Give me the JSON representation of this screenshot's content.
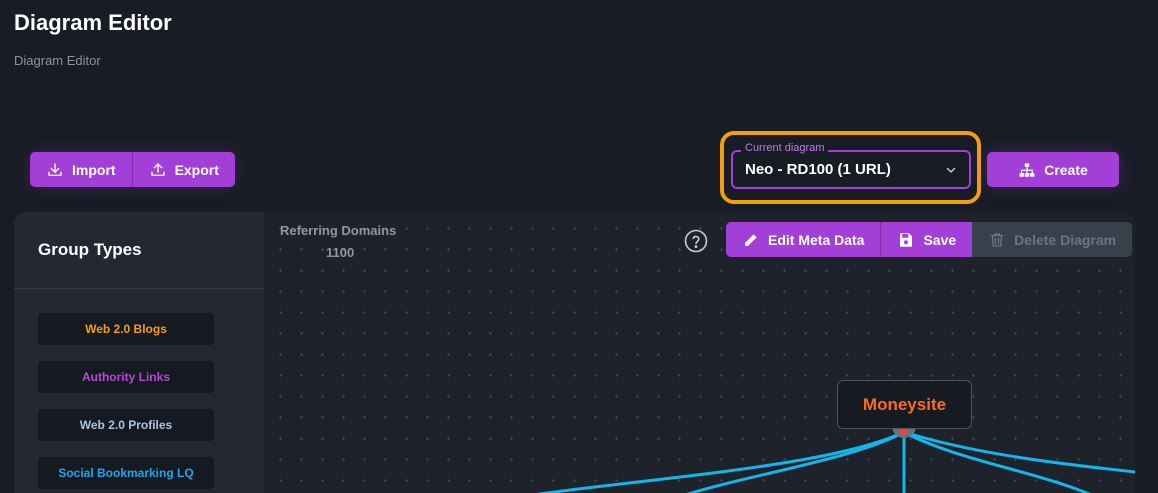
{
  "header": {
    "title": "Diagram Editor",
    "subtitle": "Diagram Editor"
  },
  "toolbar": {
    "import_label": "Import",
    "export_label": "Export",
    "create_label": "Create"
  },
  "diagram_selector": {
    "legend": "Current diagram",
    "value": "Neo - RD100 (1 URL)"
  },
  "sidebar": {
    "title": "Group Types",
    "items": [
      {
        "label": "Web 2.0 Blogs",
        "color": "#f59e0b"
      },
      {
        "label": "Authority Links",
        "color": "#b54bd0"
      },
      {
        "label": "Web 2.0 Profiles",
        "color": "#a9c4de"
      },
      {
        "label": "Social Bookmarking LQ",
        "color": "#1ea7e8"
      }
    ]
  },
  "canvas": {
    "stat_label": "Referring Domains",
    "stat_value": "1100",
    "edit_meta_label": "Edit Meta Data",
    "save_label": "Save",
    "delete_label": "Delete Diagram",
    "node_label": "Moneysite",
    "edge_color": "#13b5ea"
  },
  "colors": {
    "accent": "#a13fd6",
    "highlight": "#f59e0b",
    "node_text": "#ff6a22"
  },
  "icons": [
    "download-icon",
    "upload-icon",
    "sitemap-icon",
    "chevron-down-icon",
    "help-circle-icon",
    "pencil-icon",
    "save-icon",
    "trash-icon"
  ]
}
